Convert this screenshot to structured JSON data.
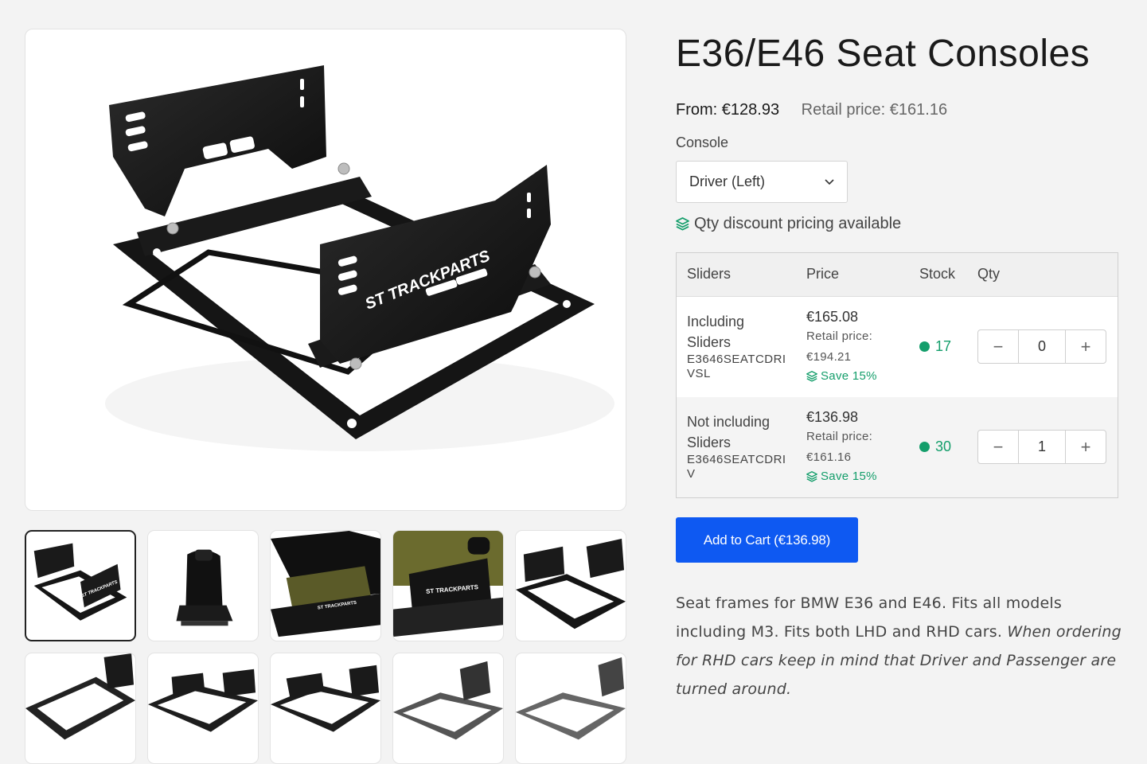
{
  "gallery": {
    "main_logo_text": "ST TRACKPARTS",
    "thumb_count": 10
  },
  "product": {
    "title": "E36/E46 Seat Consoles",
    "from_price": "From: €128.93",
    "retail_price": "Retail price: €161.16"
  },
  "console": {
    "label": "Console",
    "selected": "Driver (Left)"
  },
  "qty_notice": "Qty discount pricing available",
  "table": {
    "headers": {
      "sliders": "Sliders",
      "price": "Price",
      "stock": "Stock",
      "qty": "Qty"
    },
    "rows": [
      {
        "name": "Including Sliders",
        "sku": "E3646SEATCDRIVSL",
        "price": "€165.08",
        "retail_label": "Retail price:",
        "retail_value": "€194.21",
        "save": "Save 15%",
        "stock": "17",
        "qty": "0"
      },
      {
        "name": "Not including Sliders",
        "sku": "E3646SEATCDRIV",
        "price": "€136.98",
        "retail_label": "Retail price:",
        "retail_value": "€161.16",
        "save": "Save 15%",
        "stock": "30",
        "qty": "1"
      }
    ],
    "minus_symbol": "−",
    "plus_symbol": "+"
  },
  "cart": {
    "label": "Add to Cart (€136.98)"
  },
  "description": {
    "plain": "Seat frames for BMW E36 and E46. Fits all models including M3. Fits both LHD and RHD cars. ",
    "italic": "When ordering for RHD cars keep in mind that Driver and Passenger are turned around."
  },
  "colors": {
    "accent": "#0e59f2",
    "stock": "#149e6b",
    "background": "#f3f3f3"
  },
  "icons": [
    "layers-icon",
    "chevron-down-icon",
    "minus-icon",
    "plus-icon",
    "stock-dot-icon"
  ]
}
